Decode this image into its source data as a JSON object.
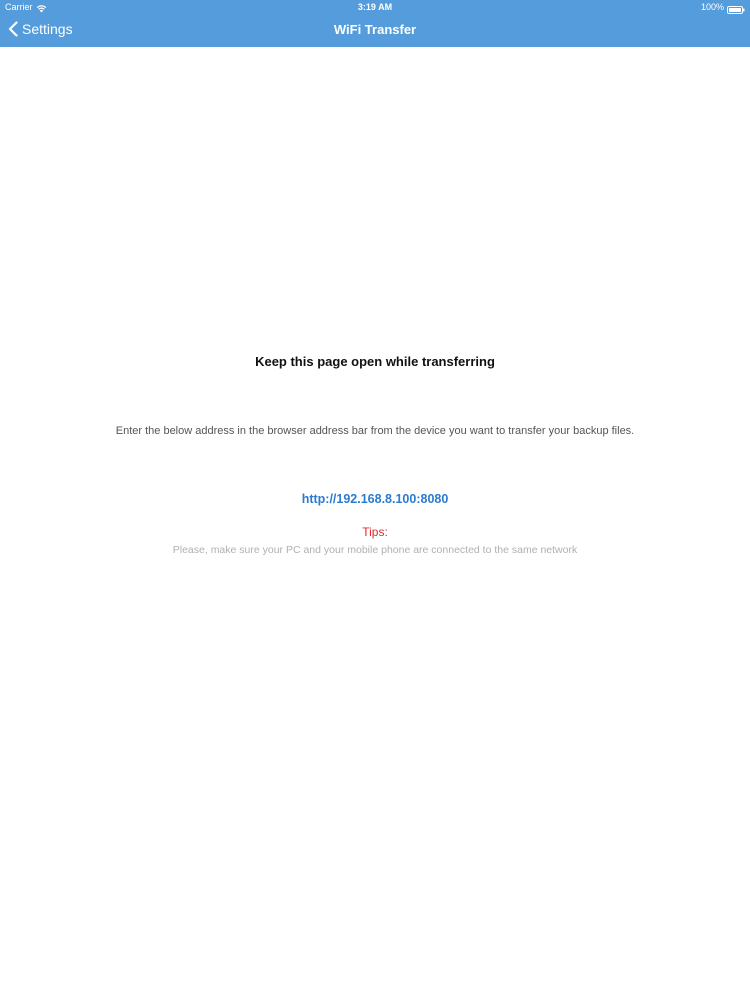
{
  "status_bar": {
    "carrier": "Carrier",
    "time": "3:19 AM",
    "battery": "100%",
    "wifi_icon": "wifi-icon",
    "battery_icon": "battery-icon"
  },
  "nav": {
    "back_label": "Settings",
    "back_icon": "chevron-left-icon",
    "title": "WiFi Transfer"
  },
  "main": {
    "heading": "Keep this page open while transferring",
    "instruction": "Enter the below address in the browser address bar from the device you want to transfer your backup files.",
    "address": "http://192.168.8.100:8080",
    "tips_label": "Tips:",
    "tips_text": "Please, make sure your PC and your mobile phone are connected to the same network"
  },
  "colors": {
    "nav_background": "#559cdc",
    "address_link": "#2a7bd1",
    "tips_label": "#e02a2a",
    "tips_text": "#b0b0b0"
  }
}
